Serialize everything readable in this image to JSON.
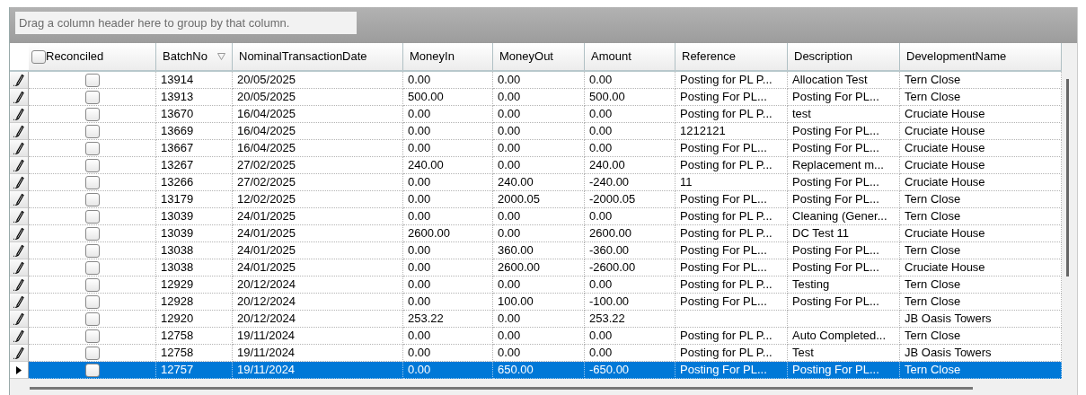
{
  "group_panel": {
    "placeholder": "Drag a column header here to group by that column."
  },
  "columns": [
    {
      "label": "Reconciled",
      "kind": "checkbox",
      "checked": false,
      "filter": false
    },
    {
      "label": "BatchNo",
      "kind": "text",
      "filter": true
    },
    {
      "label": "NominalTransactionDate",
      "kind": "text",
      "filter": false
    },
    {
      "label": "MoneyIn",
      "kind": "text",
      "filter": false
    },
    {
      "label": "MoneyOut",
      "kind": "text",
      "filter": false
    },
    {
      "label": "Amount",
      "kind": "text",
      "filter": false
    },
    {
      "label": "Reference",
      "kind": "text",
      "filter": false
    },
    {
      "label": "Description",
      "kind": "text",
      "filter": false
    },
    {
      "label": "DevelopmentName",
      "kind": "text",
      "filter": false
    }
  ],
  "rows": [
    {
      "selected": false,
      "reconciled": false,
      "batch_no": "13914",
      "date": "20/05/2025",
      "money_in": "0.00",
      "money_out": "0.00",
      "amount": "0.00",
      "reference": "Posting for PL P...",
      "description": "Allocation Test",
      "development_name": "Tern Close"
    },
    {
      "selected": false,
      "reconciled": false,
      "batch_no": "13913",
      "date": "20/05/2025",
      "money_in": "500.00",
      "money_out": "0.00",
      "amount": "500.00",
      "reference": "Posting For PL...",
      "description": "Posting For PL...",
      "development_name": "Tern Close"
    },
    {
      "selected": false,
      "reconciled": false,
      "batch_no": "13670",
      "date": "16/04/2025",
      "money_in": "0.00",
      "money_out": "0.00",
      "amount": "0.00",
      "reference": "Posting for PL P...",
      "description": "test",
      "development_name": "Cruciate House"
    },
    {
      "selected": false,
      "reconciled": false,
      "batch_no": "13669",
      "date": "16/04/2025",
      "money_in": "0.00",
      "money_out": "0.00",
      "amount": "0.00",
      "reference": "1212121",
      "description": "Posting For PL...",
      "development_name": "Cruciate House"
    },
    {
      "selected": false,
      "reconciled": false,
      "batch_no": "13667",
      "date": "16/04/2025",
      "money_in": "0.00",
      "money_out": "0.00",
      "amount": "0.00",
      "reference": "Posting For PL...",
      "description": "Posting For PL...",
      "development_name": "Cruciate House"
    },
    {
      "selected": false,
      "reconciled": false,
      "batch_no": "13267",
      "date": "27/02/2025",
      "money_in": "240.00",
      "money_out": "0.00",
      "amount": "240.00",
      "reference": "Posting for PL P...",
      "description": "Replacement m...",
      "development_name": "Cruciate House"
    },
    {
      "selected": false,
      "reconciled": false,
      "batch_no": "13266",
      "date": "27/02/2025",
      "money_in": "0.00",
      "money_out": "240.00",
      "amount": "-240.00",
      "reference": "11",
      "description": "Posting For PL...",
      "development_name": "Cruciate House"
    },
    {
      "selected": false,
      "reconciled": false,
      "batch_no": "13179",
      "date": "12/02/2025",
      "money_in": "0.00",
      "money_out": "2000.05",
      "amount": "-2000.05",
      "reference": "Posting For PL...",
      "description": "Posting For PL...",
      "development_name": "Tern Close"
    },
    {
      "selected": false,
      "reconciled": false,
      "batch_no": "13039",
      "date": "24/01/2025",
      "money_in": "0.00",
      "money_out": "0.00",
      "amount": "0.00",
      "reference": "Posting for PL P...",
      "description": "Cleaning (Gener...",
      "development_name": "Tern Close"
    },
    {
      "selected": false,
      "reconciled": false,
      "batch_no": "13039",
      "date": "24/01/2025",
      "money_in": "2600.00",
      "money_out": "0.00",
      "amount": "2600.00",
      "reference": "Posting for PL P...",
      "description": "DC Test 11",
      "development_name": "Cruciate House"
    },
    {
      "selected": false,
      "reconciled": false,
      "batch_no": "13038",
      "date": "24/01/2025",
      "money_in": "0.00",
      "money_out": "360.00",
      "amount": "-360.00",
      "reference": "Posting For PL...",
      "description": "Posting For PL...",
      "development_name": "Tern Close"
    },
    {
      "selected": false,
      "reconciled": false,
      "batch_no": "13038",
      "date": "24/01/2025",
      "money_in": "0.00",
      "money_out": "2600.00",
      "amount": "-2600.00",
      "reference": "Posting For PL...",
      "description": "Posting For PL...",
      "development_name": "Cruciate House"
    },
    {
      "selected": false,
      "reconciled": false,
      "batch_no": "12929",
      "date": "20/12/2024",
      "money_in": "0.00",
      "money_out": "0.00",
      "amount": "0.00",
      "reference": "Posting for PL P...",
      "description": "Testing",
      "development_name": "Tern Close"
    },
    {
      "selected": false,
      "reconciled": false,
      "batch_no": "12928",
      "date": "20/12/2024",
      "money_in": "0.00",
      "money_out": "100.00",
      "amount": "-100.00",
      "reference": "Posting For PL...",
      "description": "Posting For PL...",
      "development_name": "Tern Close"
    },
    {
      "selected": false,
      "reconciled": false,
      "batch_no": "12920",
      "date": "20/12/2024",
      "money_in": "253.22",
      "money_out": "0.00",
      "amount": "253.22",
      "development_name": "JB Oasis Towers"
    },
    {
      "selected": false,
      "reconciled": false,
      "batch_no": "12758",
      "date": "19/11/2024",
      "money_in": "0.00",
      "money_out": "0.00",
      "amount": "0.00",
      "reference": "Posting for PL P...",
      "description": "Auto  Completed...",
      "development_name": "Tern Close"
    },
    {
      "selected": false,
      "reconciled": false,
      "batch_no": "12758",
      "date": "19/11/2024",
      "money_in": "0.00",
      "money_out": "0.00",
      "amount": "0.00",
      "reference": "Posting for PL P...",
      "description": "Test",
      "development_name": "JB Oasis Towers"
    },
    {
      "selected": true,
      "reconciled": false,
      "batch_no": "12757",
      "date": "19/11/2024",
      "money_in": "0.00",
      "money_out": "650.00",
      "amount": "-650.00",
      "reference": "Posting For PL...",
      "description": "Posting For PL...",
      "development_name": "Tern Close"
    }
  ]
}
